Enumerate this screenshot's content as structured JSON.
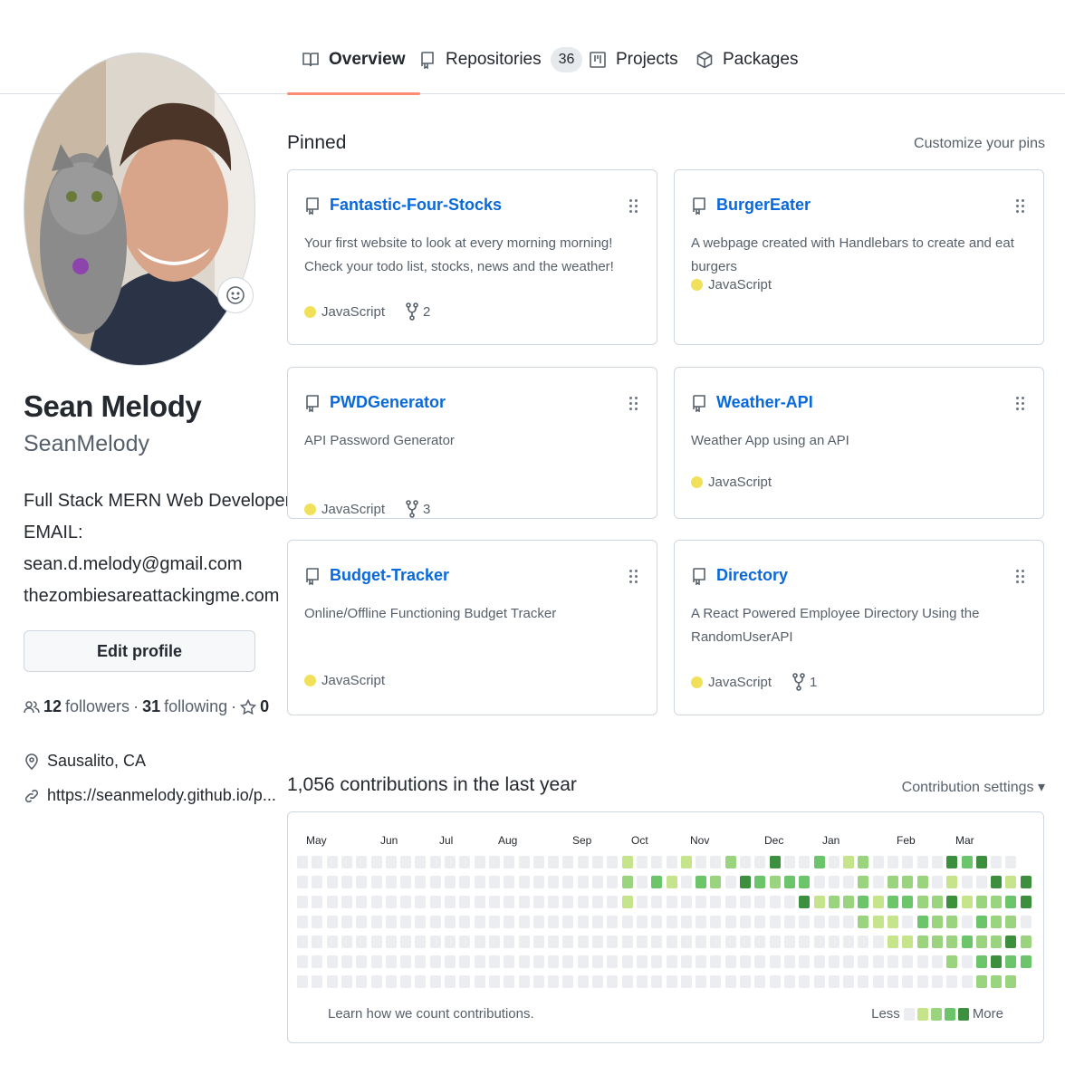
{
  "tabs": [
    {
      "label": "Overview",
      "icon": "book-icon",
      "active": true
    },
    {
      "label": "Repositories",
      "icon": "repo-icon",
      "count": "36"
    },
    {
      "label": "Projects",
      "icon": "project-icon"
    },
    {
      "label": "Packages",
      "icon": "package-icon"
    }
  ],
  "profile": {
    "full_name": "Sean Melody",
    "username": "SeanMelody",
    "bio": [
      "Full Stack MERN Web Developer",
      "EMAIL:",
      "sean.d.melody@gmail.com",
      "thezombiesareattackingme.com"
    ],
    "edit_label": "Edit profile",
    "followers_count": "12",
    "followers_label": "followers",
    "sep": "·",
    "following_count": "31",
    "following_label": "following",
    "stars_count": "0",
    "location": "Sausalito, CA",
    "website": "https://seanmelody.github.io/p..."
  },
  "pinned": {
    "title": "Pinned",
    "customize_label": "Customize your pins",
    "repos": [
      {
        "name": "Fantastic-Four-Stocks",
        "description": "Your first website to look at every morning morning! Check your todo list, stocks, news and the weather!",
        "language": "JavaScript",
        "forks": "2"
      },
      {
        "name": "BurgerEater",
        "description": "A webpage created with Handlebars to create and eat burgers",
        "language": "JavaScript",
        "forks": ""
      },
      {
        "name": "PWDGenerator",
        "description": "API Password Generator",
        "language": "JavaScript",
        "forks": "3"
      },
      {
        "name": "Weather-API",
        "description": "Weather App using an API",
        "language": "JavaScript",
        "forks": ""
      },
      {
        "name": "Budget-Tracker",
        "description": "Online/Offline Functioning Budget Tracker",
        "language": "JavaScript",
        "forks": ""
      },
      {
        "name": "Directory",
        "description": "A React Powered Employee Directory Using the RandomUserAPI",
        "language": "JavaScript",
        "forks": "1"
      }
    ]
  },
  "contributions": {
    "title": "1,056 contributions in the last year",
    "settings_label": "Contribution settings ▾",
    "months": [
      "May",
      "Jun",
      "Jul",
      "Aug",
      "Sep",
      "Oct",
      "Nov",
      "Dec",
      "Jan",
      "Feb",
      "Mar"
    ],
    "learn_label": "Learn how we count contributions.",
    "less_label": "Less",
    "more_label": "More",
    "palette": [
      "#ebedf0",
      "#c6e48b",
      "#9bd47f",
      "#6cc56a",
      "#3c8f3c"
    ],
    "grid": [
      "000000000000000000000010001002004003012000004340",
      "000000000000000000000020310320432330002022201004140",
      "000000000000000000000010000000000041223133224122341202204040",
      "0000000000000000000000000000000000000021103220322002333223323222333303",
      "00000000000000000000000000000000000000001122232242324231222333303220340",
      "000000000000000000000000000000000000000000002034333302004302303333322230",
      "000000000000000000000000000000000000000000000022233202022330003223344220"
    ]
  },
  "colors": {
    "link": "#0969da",
    "tab_underline": "#fd8c73",
    "javascript": "#f1e05a"
  }
}
